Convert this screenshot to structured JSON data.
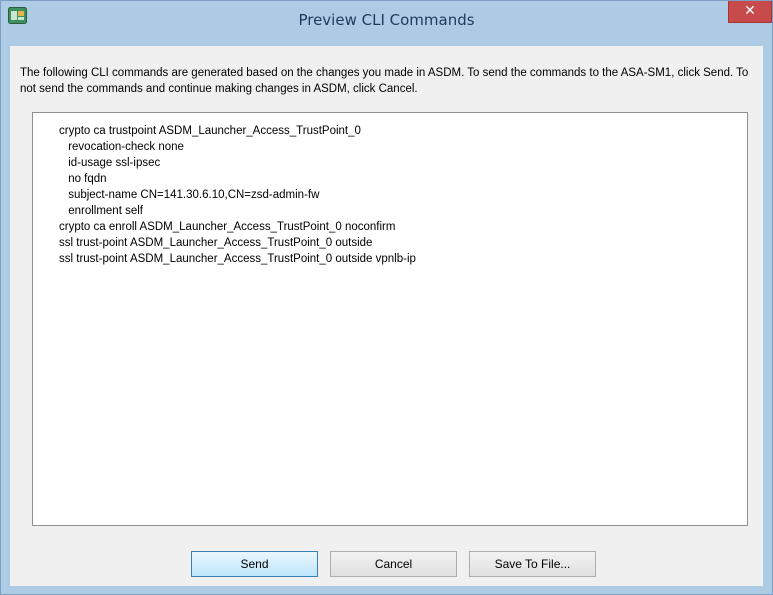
{
  "window": {
    "title": "Preview CLI Commands",
    "close_label": "✕"
  },
  "description": "The following CLI commands are generated based on the changes you made in ASDM. To send the commands to the ASA-SM1, click Send. To not send the commands and continue making changes in ASDM, click Cancel.",
  "commands": [
    "crypto ca trustpoint ASDM_Launcher_Access_TrustPoint_0",
    " revocation-check none",
    " id-usage ssl-ipsec",
    " no fqdn",
    " subject-name CN=141.30.6.10,CN=zsd-admin-fw",
    " enrollment self",
    "crypto ca enroll ASDM_Launcher_Access_TrustPoint_0 noconfirm",
    "ssl trust-point ASDM_Launcher_Access_TrustPoint_0 outside",
    "ssl trust-point ASDM_Launcher_Access_TrustPoint_0 outside vpnlb-ip"
  ],
  "buttons": {
    "send": "Send",
    "cancel": "Cancel",
    "save": "Save To File..."
  },
  "colors": {
    "titlebar": "#aecbe6",
    "close_button": "#c74b4b",
    "default_button_border": "#3c7fb1"
  }
}
